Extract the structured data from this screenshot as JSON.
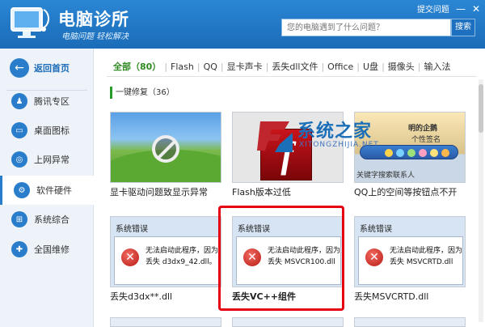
{
  "header": {
    "title": "电脑诊所",
    "slogan": "电脑问题  轻松解决",
    "feedback": "提交问题",
    "minimize": "—",
    "close": "✕",
    "search_placeholder": "您的电脑遇到了什么问题？",
    "search_button": "搜索"
  },
  "sidebar": {
    "back": "返回首页",
    "items": [
      {
        "label": "腾讯专区",
        "icon": "qq-penguin-icon"
      },
      {
        "label": "桌面图标",
        "icon": "monitor-icon"
      },
      {
        "label": "上网异常",
        "icon": "globe-icon"
      },
      {
        "label": "软件硬件",
        "icon": "gear-icon"
      },
      {
        "label": "系统综合",
        "icon": "windows-icon"
      },
      {
        "label": "全国维修",
        "icon": "wrench-icon"
      }
    ],
    "active_index": 3
  },
  "tabs": [
    "全部（80）",
    "Flash",
    "QQ",
    "显卡声卡",
    "丢失dll文件",
    "Office",
    "U盘",
    "摄像头",
    "输入法"
  ],
  "section": "一键修复（36）",
  "cards": [
    {
      "caption": "显卡驱动问题致显示异常"
    },
    {
      "caption": "Flash版本过低"
    },
    {
      "caption": "QQ上的空间等按钮点不开"
    },
    {
      "caption": "丢失d3dx**.dll",
      "dialog_title": "系统错误",
      "msg1": "无法启动此程序，因为",
      "msg2": "丢失 d3dx9_42.dll。"
    },
    {
      "caption": "丢失VC++组件",
      "dialog_title": "系统错误",
      "msg1": "无法启动此程序，因为",
      "msg2": "丢失 MSVCR100.dll"
    },
    {
      "caption": "丢失MSVCRTD.dll",
      "dialog_title": "系统错误",
      "msg1": "无法启动此程序，因为",
      "msg2": "丢失 MSVCRTD.dll"
    }
  ],
  "qq_thumb": {
    "line1": "明的企鹅",
    "line2": "个性签名",
    "line3": "关键字搜索联系人"
  },
  "watermark": {
    "cn": "系统之家",
    "en": "XITONGZHIJIA.NET"
  },
  "colors": {
    "header": "#1b6cb8",
    "accent_green": "#2f8a22",
    "highlight": "#e60012"
  }
}
